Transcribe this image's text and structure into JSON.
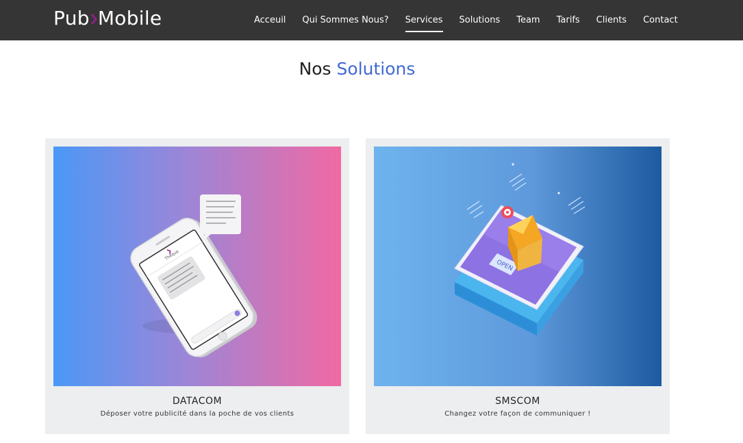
{
  "header": {
    "logo_left": "Pub",
    "logo_right": "Mobile",
    "nav": [
      {
        "label": "Acceuil"
      },
      {
        "label": "Qui Sommes Nous?"
      },
      {
        "label": "Services"
      },
      {
        "label": "Solutions"
      },
      {
        "label": "Team"
      },
      {
        "label": "Tarifs"
      },
      {
        "label": "Clients"
      },
      {
        "label": "Contact"
      }
    ],
    "active_nav": "Services"
  },
  "section": {
    "title_prefix": "Nos",
    "title_highlight": "Solutions"
  },
  "cards": [
    {
      "name": "DATACOM",
      "description": "Déposer votre publicité dans la poche de vos clients"
    },
    {
      "name": "SMSCOM",
      "description": "Changez votre façon de communiquer !"
    }
  ],
  "illustration": {
    "open_label": "OPEN"
  },
  "colors": {
    "header_bg": "#353535",
    "accent": "#4169d4",
    "logo_mark": "#8e1f8a",
    "card_bg": "#eceeef"
  }
}
